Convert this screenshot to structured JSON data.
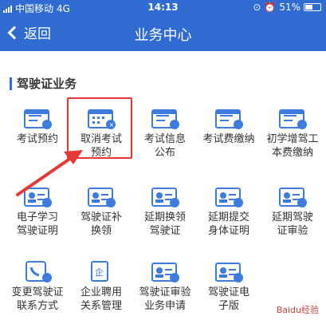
{
  "status": {
    "carrier": "中国移动",
    "network": "4G",
    "time": "14:13",
    "battery": "51%",
    "battery_level": 0.51
  },
  "nav": {
    "back_label": "返回",
    "title": "业务中心"
  },
  "section": {
    "title": "驾驶证业务"
  },
  "items": [
    {
      "l1": "考试预约",
      "l2": "",
      "icon": "calendar-card-icon"
    },
    {
      "l1": "取消考试",
      "l2": "预约",
      "icon": "calendar-cancel-icon"
    },
    {
      "l1": "考试信息",
      "l2": "公布",
      "icon": "announce-card-icon"
    },
    {
      "l1": "考试费缴纳",
      "l2": "",
      "icon": "payment-card-icon"
    },
    {
      "l1": "初学增驾工",
      "l2": "本费缴纳",
      "icon": "fee-doc-icon"
    },
    {
      "l1": "电子学习",
      "l2": "驾驶证明",
      "icon": "e-cert-icon"
    },
    {
      "l1": "驾驶证补",
      "l2": "换领",
      "icon": "license-replace-icon"
    },
    {
      "l1": "延期换领",
      "l2": "驾驶证",
      "icon": "license-extend-icon"
    },
    {
      "l1": "延期提交",
      "l2": "身体证明",
      "icon": "health-report-icon"
    },
    {
      "l1": "延期驾驶",
      "l2": "证审验",
      "icon": "license-review-icon"
    },
    {
      "l1": "变更驾驶证",
      "l2": "联系方式",
      "icon": "contact-change-icon"
    },
    {
      "l1": "企业聘用",
      "l2": "关系管理",
      "icon": "enterprise-icon"
    },
    {
      "l1": "驾驶证审验",
      "l2": "业务申请",
      "icon": "review-apply-icon"
    },
    {
      "l1": "驾驶证电",
      "l2": "子版",
      "icon": "e-license-icon"
    }
  ],
  "watermark": "Baidu经验",
  "colors": {
    "primary": "#2f6bd0",
    "highlight": "#e53935",
    "icon_blue": "#3d7be0"
  }
}
